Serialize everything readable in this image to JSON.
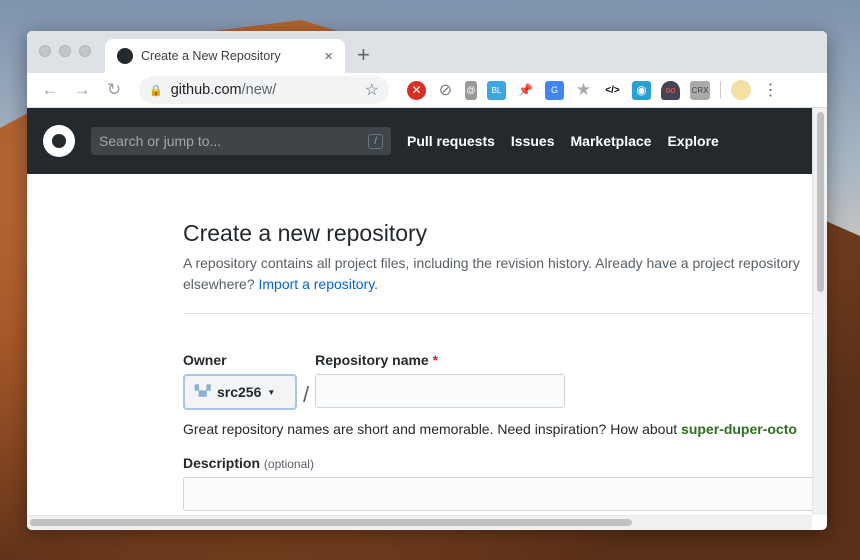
{
  "tab": {
    "title": "Create a New Repository",
    "close": "×",
    "new": "+"
  },
  "address": {
    "host": "github.com",
    "path": "/new/",
    "star": "☆"
  },
  "nav": {
    "back": "←",
    "forward": "→",
    "reload": "↻",
    "menu": "⋮"
  },
  "extensions": [
    "error-extension",
    "block-extension",
    "doc-extension",
    "bl-extension",
    "pin-extension",
    "translate-extension",
    "star-extension",
    "code-extension",
    "camera-extension",
    "spy-extension",
    "crx-extension"
  ],
  "extension_labels": {
    "code": "</>",
    "crx": "CRX",
    "bl": "BL"
  },
  "header": {
    "search_placeholder": "Search or jump to...",
    "search_key": "/",
    "menu": [
      "Pull requests",
      "Issues",
      "Marketplace",
      "Explore"
    ]
  },
  "page": {
    "title": "Create a new repository",
    "subtitle": "A repository contains all project files, including the revision history. Already have a project repository",
    "subtitle2": "elsewhere?",
    "import_link": "Import a repository.",
    "owner_label": "Owner",
    "owner_value": "src256",
    "repo_label": "Repository name",
    "required": "*",
    "slash": "/",
    "hint": "Great repository names are short and memorable. Need inspiration? How about",
    "suggestion": "super-duper-octo",
    "desc_label": "Description",
    "desc_optional": "(optional)"
  }
}
